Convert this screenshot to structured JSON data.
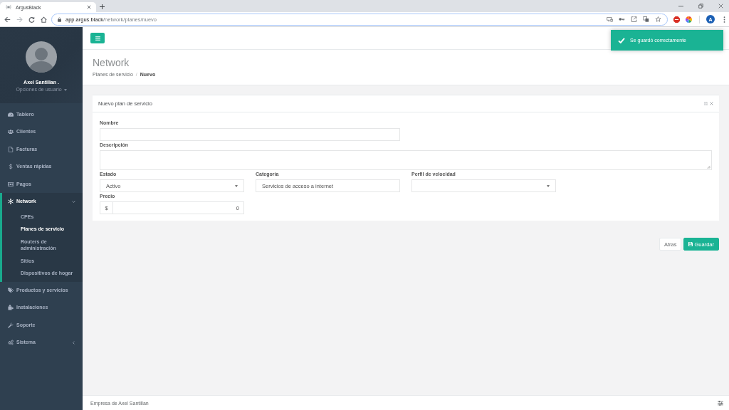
{
  "browser": {
    "tab": {
      "title": "ArgusBlack"
    },
    "nav": {
      "forward_disabled": true
    },
    "address": {
      "host": "app.argus.black",
      "path": "/network/planes/nuevo"
    },
    "profile": {
      "initial": "A"
    }
  },
  "sidebar": {
    "user": {
      "name": "Axel Santillan .",
      "menu_label": "Opciones de usuario"
    },
    "items": [
      {
        "label": "Tablero",
        "selected": false
      },
      {
        "label": "Clientes",
        "selected": false
      },
      {
        "label": "Facturas",
        "selected": false
      },
      {
        "label": "Ventas rápidas",
        "selected": false
      },
      {
        "label": "Pagos",
        "selected": false
      },
      {
        "label": "Network",
        "selected": true,
        "expanded": true,
        "children": [
          {
            "label": "CPEs",
            "selected": false
          },
          {
            "label": "Planes de servicio",
            "selected": true
          },
          {
            "label": "Routers de administración",
            "selected": false
          },
          {
            "label": "Sitios",
            "selected": false
          },
          {
            "label": "Dispositivos de hogar",
            "selected": false
          }
        ]
      },
      {
        "label": "Productos y servicios",
        "selected": false
      },
      {
        "label": "Instalaciones",
        "selected": false
      },
      {
        "label": "Soporte",
        "selected": false
      },
      {
        "label": "Sistema",
        "selected": false,
        "expanded": false
      }
    ]
  },
  "toast": {
    "message": "Se guardó correctamente"
  },
  "page_header": {
    "title": "Network",
    "separator": "/",
    "breadcrumb": [
      {
        "label": "Planes de servicio",
        "current": false
      },
      {
        "label": "Nuevo",
        "current": true
      }
    ]
  },
  "card": {
    "title": "Nuevo plan de servicio",
    "fields": [
      {
        "label": "Nombre",
        "kind": "text"
      },
      {
        "label": "Descripción",
        "kind": "textarea"
      },
      {
        "label": "Estado",
        "kind": "select",
        "value": "Activo"
      },
      {
        "label": "Categoría",
        "kind": "text",
        "value": "Servicios de acceso a internet"
      },
      {
        "label": "Perfil de velocidad",
        "kind": "select"
      },
      {
        "label": "Precio",
        "kind": "currency",
        "addon": "$",
        "value": "0"
      }
    ]
  },
  "actions": [
    {
      "label": "Atras",
      "kind": "default"
    },
    {
      "label": "Guardar",
      "kind": "primary"
    }
  ],
  "footer": {
    "text": "Empresa de Axel Santillan"
  }
}
